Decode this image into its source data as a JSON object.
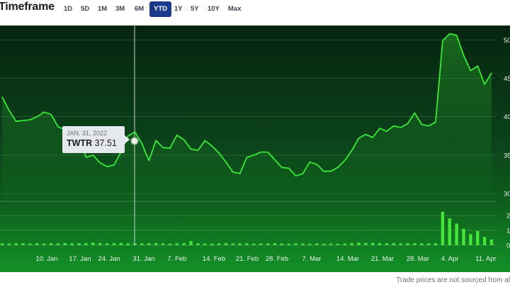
{
  "header": {
    "title": "Timeframe",
    "buttons": [
      "1D",
      "5D",
      "1M",
      "3M",
      "6M",
      "YTD",
      "1Y",
      "5Y",
      "10Y",
      "Max"
    ],
    "active": "YTD"
  },
  "tooltip": {
    "date": "JAN. 31, 2022",
    "symbol": "TWTR",
    "price": "37.51"
  },
  "footer": {
    "note": "Trade prices are not sourced from al"
  },
  "colors": {
    "line": "#39e839",
    "volume": "#44e63a",
    "active_button": "#1c3a8c"
  },
  "chart_data": {
    "type": "line",
    "xlabels": [
      "10. Jan",
      "17. Jan",
      "24. Jan",
      "31. Jan",
      "7. Feb",
      "14. Feb",
      "21. Feb",
      "28. Feb",
      "7. Mar",
      "14. Mar",
      "21. Mar",
      "28. Mar",
      "4. Apr",
      "11. Apr"
    ],
    "price_ticks": [
      "50",
      "45",
      "40",
      "35",
      "30"
    ],
    "volume_ticks": [
      "2",
      "1",
      "0"
    ],
    "ylim": [
      29,
      51.5
    ],
    "series": [
      {
        "values": [
          42.6,
          40.8,
          39.4,
          39.5,
          39.6,
          40.0,
          40.6,
          40.3,
          38.7,
          38.3,
          38.3,
          37.8,
          34.7,
          35.0,
          34.0,
          33.5,
          33.7,
          35.4,
          37.5,
          38.0,
          36.5,
          34.3,
          36.9,
          36.0,
          35.9,
          37.6,
          37.0,
          35.8,
          35.6,
          36.9,
          36.2,
          35.3,
          34.1,
          32.8,
          32.6,
          34.7,
          35.0,
          35.4,
          35.4,
          34.4,
          33.4,
          33.3,
          32.3,
          32.6,
          34.1,
          33.8,
          32.9,
          32.9,
          33.4,
          34.3,
          35.6,
          37.2,
          37.7,
          37.3,
          38.5,
          38.1,
          38.8,
          38.6,
          39.1,
          40.5,
          39.0,
          38.8,
          39.3,
          49.9,
          50.8,
          50.6,
          48.0,
          46.0,
          46.6,
          44.2,
          45.7
        ]
      },
      {
        "values": [
          0.12,
          0.11,
          0.12,
          0.13,
          0.11,
          0.12,
          0.11,
          0.13,
          0.12,
          0.14,
          0.12,
          0.13,
          0.14,
          0.18,
          0.14,
          0.12,
          0.13,
          0.15,
          0.12,
          0.11,
          0.12,
          0.13,
          0.14,
          0.12,
          0.1,
          0.12,
          0.13,
          0.28,
          0.12,
          0.11,
          0.1,
          0.12,
          0.13,
          0.11,
          0.12,
          0.12,
          0.1,
          0.11,
          0.12,
          0.13,
          0.11,
          0.1,
          0.12,
          0.11,
          0.1,
          0.12,
          0.1,
          0.11,
          0.09,
          0.11,
          0.14,
          0.17,
          0.15,
          0.16,
          0.14,
          0.13,
          0.14,
          0.12,
          0.13,
          0.14,
          0.12,
          0.12,
          0.13,
          2.25,
          1.8,
          1.45,
          1.1,
          0.75,
          0.95,
          0.55,
          0.38
        ]
      }
    ]
  }
}
